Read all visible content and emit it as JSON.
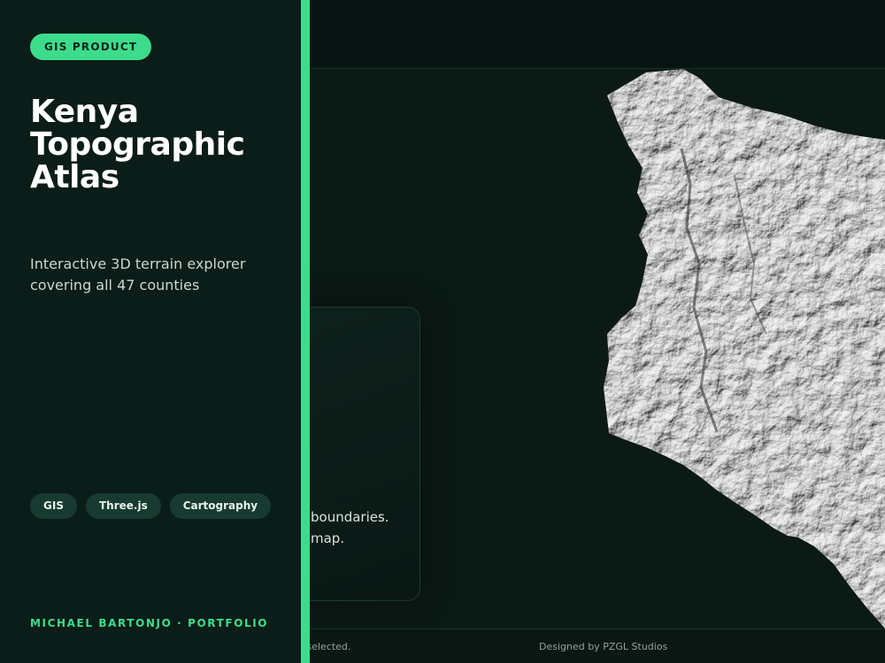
{
  "panel": {
    "badge": "GIS PRODUCT",
    "title_lines": [
      "Kenya",
      "Topographic",
      "Atlas"
    ],
    "subtitle_lines": [
      "Interactive 3D terrain explorer",
      "covering all 47 counties"
    ],
    "tags": [
      "GIS",
      "Three.js",
      "Cartography"
    ],
    "author": "MICHAEL BARTONJO · PORTFOLIO"
  },
  "info_card": {
    "line1": "boundaries.",
    "line2": "map."
  },
  "footer": {
    "status": "n selected.",
    "credit": "Designed by PZGL Studios"
  },
  "colors": {
    "accent": "#3ddc8c",
    "panel_bg": "#0b1d18",
    "stage_bg": "#0c1a16",
    "tag_bg": "#173a31",
    "terrain": "#b9b9b9"
  },
  "icons": {
    "map": "kenya-terrain-map"
  }
}
